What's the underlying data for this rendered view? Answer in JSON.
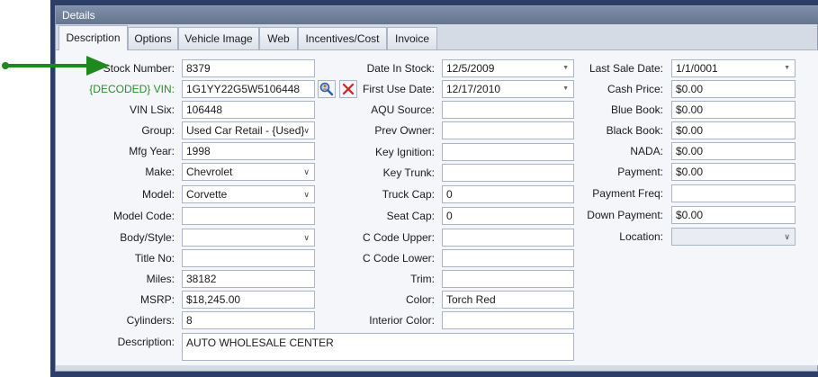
{
  "header": {
    "title": "Details"
  },
  "tabs": [
    {
      "label": "Description"
    },
    {
      "label": "Options"
    },
    {
      "label": "Vehicle Image"
    },
    {
      "label": "Web"
    },
    {
      "label": "Incentives/Cost"
    },
    {
      "label": "Invoice"
    }
  ],
  "left": {
    "stock_number": {
      "label": "Stock Number:",
      "value": "8379"
    },
    "vin": {
      "label": "{DECODED} VIN:",
      "value": "1G1YY22G5W5106448"
    },
    "vin_lsix": {
      "label": "VIN LSix:",
      "value": "106448"
    },
    "group": {
      "label": "Group:",
      "value": "Used Car Retail - {Used}"
    },
    "mfg_year": {
      "label": "Mfg Year:",
      "value": "1998"
    },
    "make": {
      "label": "Make:",
      "value": "Chevrolet"
    },
    "model": {
      "label": "Model:",
      "value": "Corvette"
    },
    "model_code": {
      "label": "Model Code:",
      "value": ""
    },
    "body_style": {
      "label": "Body/Style:",
      "value": ""
    },
    "title_no": {
      "label": "Title No:",
      "value": ""
    },
    "miles": {
      "label": "Miles:",
      "value": "38182"
    },
    "msrp": {
      "label": "MSRP:",
      "value": "$18,245.00"
    },
    "cylinders": {
      "label": "Cylinders:",
      "value": "8"
    },
    "description": {
      "label": "Description:",
      "value": "AUTO WHOLESALE CENTER"
    }
  },
  "middle": {
    "date_in_stock": {
      "label": "Date In Stock:",
      "value": "12/5/2009"
    },
    "first_use_date": {
      "label": "First Use Date:",
      "value": "12/17/2010"
    },
    "aqu_source": {
      "label": "AQU Source:",
      "value": ""
    },
    "prev_owner": {
      "label": "Prev Owner:",
      "value": ""
    },
    "key_ignition": {
      "label": "Key Ignition:",
      "value": ""
    },
    "key_trunk": {
      "label": "Key Trunk:",
      "value": ""
    },
    "truck_cap": {
      "label": "Truck Cap:",
      "value": "0"
    },
    "seat_cap": {
      "label": "Seat Cap:",
      "value": "0"
    },
    "c_code_upper": {
      "label": "C Code Upper:",
      "value": ""
    },
    "c_code_lower": {
      "label": "C Code Lower:",
      "value": ""
    },
    "trim": {
      "label": "Trim:",
      "value": ""
    },
    "color": {
      "label": "Color:",
      "value": "Torch Red"
    },
    "interior_color": {
      "label": "Interior Color:",
      "value": ""
    }
  },
  "right": {
    "last_sale_date": {
      "label": "Last Sale Date:",
      "value": "1/1/0001"
    },
    "cash_price": {
      "label": "Cash Price:",
      "value": "$0.00"
    },
    "blue_book": {
      "label": "Blue Book:",
      "value": "$0.00"
    },
    "black_book": {
      "label": "Black Book:",
      "value": "$0.00"
    },
    "nada": {
      "label": "NADA:",
      "value": "$0.00"
    },
    "payment": {
      "label": "Payment:",
      "value": "$0.00"
    },
    "payment_freq": {
      "label": "Payment Freq:",
      "value": ""
    },
    "down_payment": {
      "label": "Down Payment:",
      "value": "$0.00"
    },
    "location": {
      "label": "Location:",
      "value": ""
    }
  },
  "icons": {
    "decode": "magnifier-person-icon",
    "clear": "red-x-icon",
    "dropdown": "chevron-down-icon",
    "date_dropdown": "triangle-down-icon",
    "annotation": "green-arrow-icon"
  },
  "colors": {
    "header_bg": "#6f7f99",
    "frame": "#2c3e68",
    "panel_bg": "#f4f6f9",
    "decoded_label": "#2e8a2e",
    "arrow": "#1e8a1e",
    "clear_icon": "#d42020"
  }
}
